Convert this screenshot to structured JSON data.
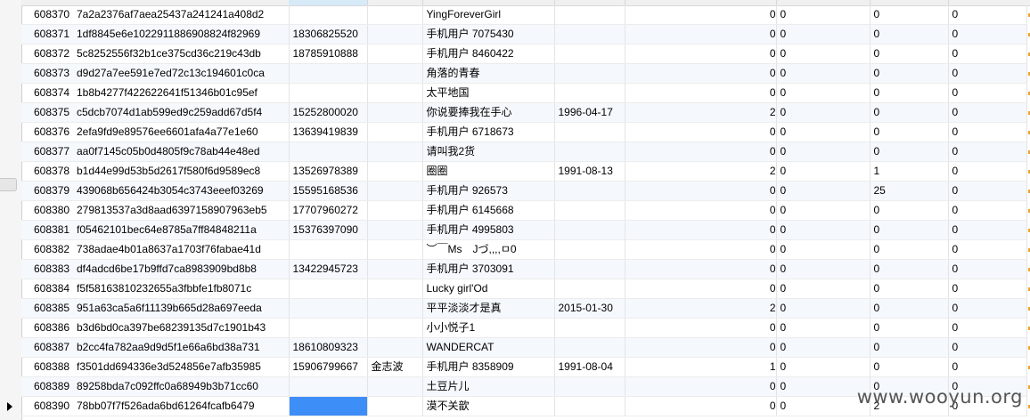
{
  "rows": [
    {
      "id": "608370",
      "hash": "7a2a2376af7aea25437a241241a408d2",
      "phone": "",
      "realname": "",
      "nickname": "YingForeverGirl",
      "birthday": "",
      "c1": "0",
      "c2": "0",
      "c3": "0",
      "c4": "0"
    },
    {
      "id": "608371",
      "hash": "1df8845e6e1022911886908824f82969",
      "phone": "18306825520",
      "realname": "",
      "nickname": "手机用户 7075430",
      "birthday": "",
      "c1": "0",
      "c2": "0",
      "c3": "0",
      "c4": "0"
    },
    {
      "id": "608372",
      "hash": "5c8252556f32b1ce375cd36c219c43db",
      "phone": "18785910888",
      "realname": "",
      "nickname": "手机用户 8460422",
      "birthday": "",
      "c1": "0",
      "c2": "0",
      "c3": "0",
      "c4": "0"
    },
    {
      "id": "608373",
      "hash": "d9d27a7ee591e7ed72c13c194601c0ca",
      "phone": "",
      "realname": "",
      "nickname": "角落的青春",
      "birthday": "",
      "c1": "0",
      "c2": "0",
      "c3": "0",
      "c4": "0"
    },
    {
      "id": "608374",
      "hash": "1b8b4277f422622641f51346b01c95ef",
      "phone": "",
      "realname": "",
      "nickname": "太平地国",
      "birthday": "",
      "c1": "0",
      "c2": "0",
      "c3": "0",
      "c4": "0"
    },
    {
      "id": "608375",
      "hash": "c5dcb7074d1ab599ed9c259add67d5f4",
      "phone": "15252800020",
      "realname": "",
      "nickname": "你说要捧我在手心",
      "birthday": "1996-04-17",
      "c1": "2",
      "c2": "0",
      "c3": "0",
      "c4": "0"
    },
    {
      "id": "608376",
      "hash": "2efa9fd9e89576ee6601afa4a77e1e60",
      "phone": "13639419839",
      "realname": "",
      "nickname": "手机用户 6718673",
      "birthday": "",
      "c1": "0",
      "c2": "0",
      "c3": "0",
      "c4": "0"
    },
    {
      "id": "608377",
      "hash": "aa0f7145c05b0d4805f9c78ab44e48ed",
      "phone": "",
      "realname": "",
      "nickname": "请叫我2货",
      "birthday": "",
      "c1": "0",
      "c2": "0",
      "c3": "0",
      "c4": "0"
    },
    {
      "id": "608378",
      "hash": "b1d44e99d53b5d2617f580f6d9589ec8",
      "phone": "13526978389",
      "realname": "",
      "nickname": "圈圈",
      "birthday": "1991-08-13",
      "c1": "2",
      "c2": "0",
      "c3": "1",
      "c4": "0"
    },
    {
      "id": "608379",
      "hash": "439068b656424b3054c3743eeef03269",
      "phone": "15595168536",
      "realname": "",
      "nickname": "手机用户 926573",
      "birthday": "",
      "c1": "0",
      "c2": "0",
      "c3": "25",
      "c4": "0"
    },
    {
      "id": "608380",
      "hash": "279813537a3d8aad6397158907963eb5",
      "phone": "17707960272",
      "realname": "",
      "nickname": "手机用户 6145668",
      "birthday": "",
      "c1": "0",
      "c2": "0",
      "c3": "0",
      "c4": "0"
    },
    {
      "id": "608381",
      "hash": "f05462101bec64e8785a7ff84848211a",
      "phone": "15376397090",
      "realname": "",
      "nickname": "手机用户 4995803",
      "birthday": "",
      "c1": "0",
      "c2": "0",
      "c3": "0",
      "c4": "0"
    },
    {
      "id": "608382",
      "hash": "738adae4b01a8637a1703f76fabae41d",
      "phone": "",
      "realname": "",
      "nickname": "︶￣Ms　Jづ,,,,ㅁ0",
      "birthday": "",
      "c1": "0",
      "c2": "0",
      "c3": "0",
      "c4": "0"
    },
    {
      "id": "608383",
      "hash": "df4adcd6be17b9ffd7ca8983909bd8b8",
      "phone": "13422945723",
      "realname": "",
      "nickname": "手机用户 3703091",
      "birthday": "",
      "c1": "0",
      "c2": "0",
      "c3": "0",
      "c4": "0"
    },
    {
      "id": "608384",
      "hash": "f5f58163810232655a3fbbfe1fb8071c",
      "phone": "",
      "realname": "",
      "nickname": "Lucky girl'Od",
      "birthday": "",
      "c1": "0",
      "c2": "0",
      "c3": "0",
      "c4": "0"
    },
    {
      "id": "608385",
      "hash": "951a63ca5a6f11139b665d28a697eeda",
      "phone": "",
      "realname": "",
      "nickname": "平平淡淡才是真",
      "birthday": "2015-01-30",
      "c1": "2",
      "c2": "0",
      "c3": "0",
      "c4": "0"
    },
    {
      "id": "608386",
      "hash": "b3d6bd0ca397be68239135d7c1901b43",
      "phone": "",
      "realname": "",
      "nickname": "小小悦子1",
      "birthday": "",
      "c1": "0",
      "c2": "0",
      "c3": "0",
      "c4": "0"
    },
    {
      "id": "608387",
      "hash": "b2cc4fa782aa9d9d5f1e66a6bd38a731",
      "phone": "18610809323",
      "realname": "",
      "nickname": "WANDERCAT",
      "birthday": "",
      "c1": "0",
      "c2": "0",
      "c3": "0",
      "c4": "0"
    },
    {
      "id": "608388",
      "hash": "f3501dd694336e3d524856e7afb35985",
      "phone": "15906799667",
      "realname": "金志波",
      "nickname": "手机用户 8358909",
      "birthday": "1991-08-04",
      "c1": "1",
      "c2": "0",
      "c3": "0",
      "c4": "0"
    },
    {
      "id": "608389",
      "hash": "89258bda7c092ffc0a68949b3b71cc60",
      "phone": "",
      "realname": "",
      "nickname": "土豆片儿",
      "birthday": "",
      "c1": "0",
      "c2": "0",
      "c3": "0",
      "c4": "0"
    },
    {
      "id": "608390",
      "hash": "78bb07f7f526ada6bd61264fcafb6479",
      "phone": "",
      "realname": "",
      "nickname": "漠不关歆",
      "birthday": "",
      "c1": "0",
      "c2": "0",
      "c3": "2",
      "c4": "0"
    }
  ],
  "current_row_index": 20,
  "selected_cell": {
    "row": 20,
    "column": "phone"
  },
  "watermark": "www.wooyun.org",
  "colors": {
    "selection": "#3e8ef7",
    "row_alt": "#f5f9fd",
    "grid_line": "#e4e4e4"
  }
}
